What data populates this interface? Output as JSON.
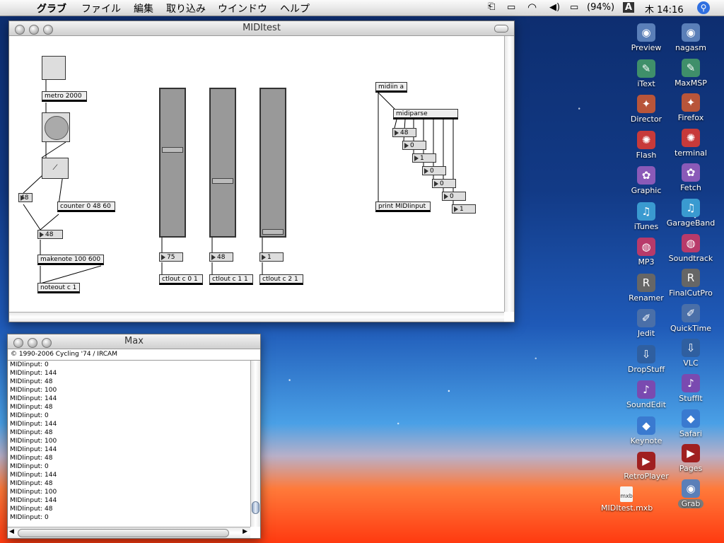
{
  "menubar": {
    "items": [
      "グラブ",
      "ファイル",
      "編集",
      "取り込み",
      "ウインドウ",
      "ヘルプ"
    ],
    "status": {
      "battery": "(94%)",
      "input": "A",
      "clock": "木 14:16"
    }
  },
  "patcher": {
    "title": "MIDItest",
    "objects": {
      "metro": "metro 2000",
      "counter": "counter 0 48 60",
      "makenote": "makenote 100 600",
      "noteout": "noteout c 1",
      "ctlout1": "ctlout c 0 1",
      "ctlout2": "ctlout c 1 1",
      "ctlout3": "ctlout c 2 1",
      "midiin": "midiin a",
      "midiparse": "midiparse",
      "print": "print MIDIinput"
    },
    "numbers": {
      "n48a": "48",
      "n48b": "48",
      "s1": "75",
      "s2": "48",
      "s3": "1",
      "p1": "48",
      "p2": "0",
      "p3": "1",
      "p4": "0",
      "p5": "0",
      "p6": "0",
      "p7": "1"
    },
    "sliders": [
      0.6,
      0.38,
      0.02
    ]
  },
  "console": {
    "title": "Max",
    "subtitle": "© 1990-2006 Cycling '74 / IRCAM",
    "lines": [
      "MIDIinput: 0",
      "MIDIinput: 144",
      "MIDIinput: 48",
      "MIDIinput: 100",
      "MIDIinput: 144",
      "MIDIinput: 48",
      "MIDIinput: 0",
      "MIDIinput: 144",
      "MIDIinput: 48",
      "MIDIinput: 100",
      "MIDIinput: 144",
      "MIDIinput: 48",
      "MIDIinput: 0",
      "MIDIinput: 144",
      "MIDIinput: 48",
      "MIDIinput: 100",
      "MIDIinput: 144",
      "MIDIinput: 48",
      "MIDIinput: 0"
    ]
  },
  "desktop": {
    "left_column": [
      "Preview",
      "iText",
      "Director",
      "Flash",
      "Graphic",
      "iTunes",
      "MP3",
      "Renamer",
      "Jedit",
      "DropStuff",
      "SoundEdit",
      "Keynote",
      "RetroPlayer"
    ],
    "right_column": [
      "nagasm",
      "MaxMSP",
      "Firefox",
      "terminal",
      "Fetch",
      "GarageBand",
      "Soundtrack",
      "FinalCutPro",
      "QuickTime",
      "VLC",
      "StuffIt",
      "Safari",
      "Pages",
      "Grab"
    ],
    "file": "MIDItest.mxb"
  }
}
